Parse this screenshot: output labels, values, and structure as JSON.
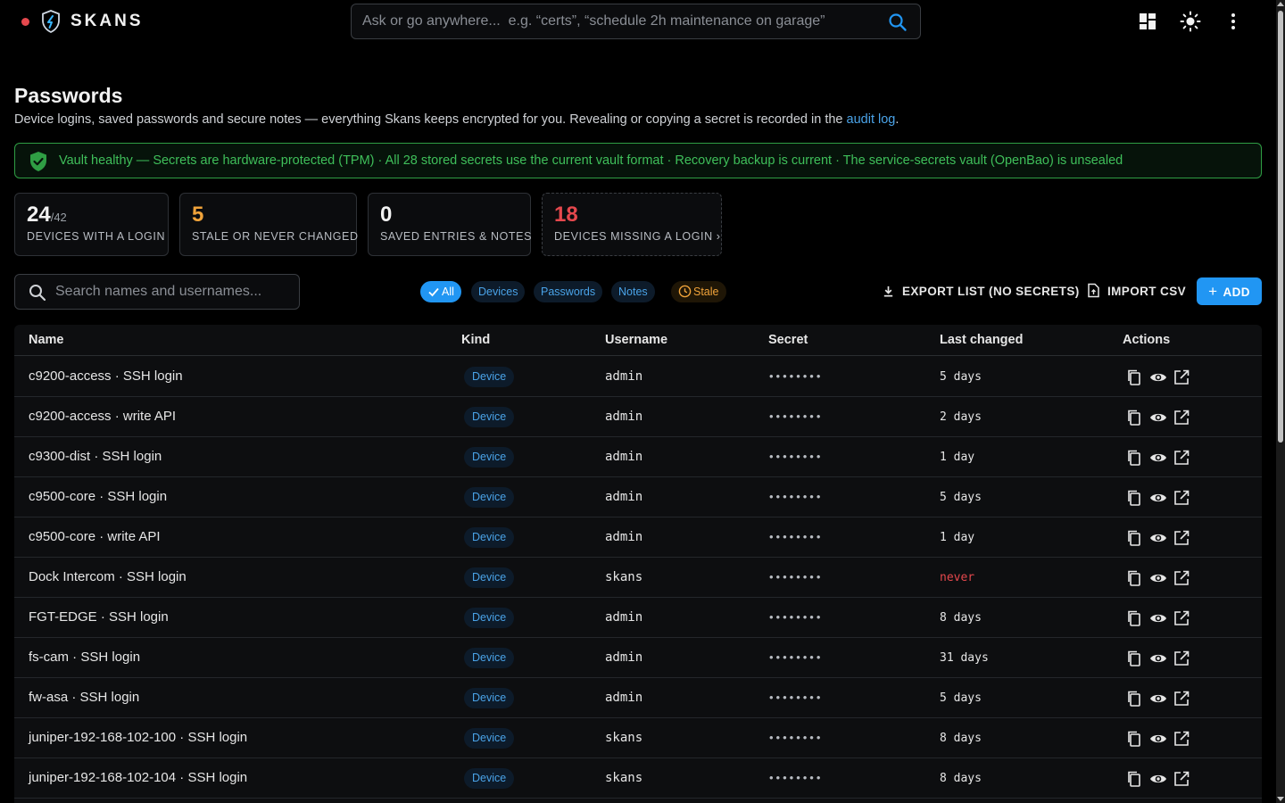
{
  "app": {
    "brand": "SKANS",
    "omnibox_placeholder": "Ask or go anywhere...  e.g. “certs”, “schedule 2h maintenance on garage”"
  },
  "page": {
    "title": "Passwords",
    "subtitle": "Device logins, saved passwords and secure notes — everything Skans keeps encrypted for you. Revealing or copying a secret is recorded in the ",
    "audit_link": "audit log",
    "subtitle_end": "."
  },
  "banner": {
    "text": "Vault healthy — Secrets are hardware-protected (TPM) · All 28 stored secrets use the current vault format · Recovery backup is current · The service-secrets vault (OpenBao) is unsealed"
  },
  "stats": [
    {
      "value": "24",
      "total": "/42",
      "label": "DEVICES WITH A LOGIN",
      "color": "#f2f2f2"
    },
    {
      "value": "5",
      "total": "",
      "label": "STALE OR NEVER CHANGED",
      "color": "#f0a33a"
    },
    {
      "value": "0",
      "total": "",
      "label": "SAVED ENTRIES & NOTES",
      "color": "#f2f2f2"
    },
    {
      "value": "18",
      "total": "",
      "label": "DEVICES MISSING A LOGIN ›",
      "color": "#e5484d"
    }
  ],
  "search": {
    "placeholder": "Search names and usernames..."
  },
  "filters": {
    "all": "All",
    "devices": "Devices",
    "passwords": "Passwords",
    "notes": "Notes",
    "stale": "Stale"
  },
  "toolbar": {
    "export": "EXPORT LIST (NO SECRETS)",
    "import": "IMPORT CSV",
    "add": "ADD"
  },
  "table": {
    "columns": {
      "name": "Name",
      "kind": "Kind",
      "username": "Username",
      "secret": "Secret",
      "changed": "Last changed",
      "actions": "Actions"
    },
    "rows": [
      {
        "name": "c9200-access · SSH login",
        "kind": "Device",
        "username": "admin",
        "secret": "••••••••",
        "changed": "5 days"
      },
      {
        "name": "c9200-access · write API",
        "kind": "Device",
        "username": "admin",
        "secret": "••••••••",
        "changed": "2 days"
      },
      {
        "name": "c9300-dist · SSH login",
        "kind": "Device",
        "username": "admin",
        "secret": "••••••••",
        "changed": "1 day"
      },
      {
        "name": "c9500-core · SSH login",
        "kind": "Device",
        "username": "admin",
        "secret": "••••••••",
        "changed": "5 days"
      },
      {
        "name": "c9500-core · write API",
        "kind": "Device",
        "username": "admin",
        "secret": "••••••••",
        "changed": "1 day"
      },
      {
        "name": "Dock Intercom · SSH login",
        "kind": "Device",
        "username": "skans",
        "secret": "••••••••",
        "changed": "never"
      },
      {
        "name": "FGT-EDGE · SSH login",
        "kind": "Device",
        "username": "admin",
        "secret": "••••••••",
        "changed": "8 days"
      },
      {
        "name": "fs-cam · SSH login",
        "kind": "Device",
        "username": "admin",
        "secret": "••••••••",
        "changed": "31 days"
      },
      {
        "name": "fw-asa · SSH login",
        "kind": "Device",
        "username": "admin",
        "secret": "••••••••",
        "changed": "5 days"
      },
      {
        "name": "juniper-192-168-102-100 · SSH login",
        "kind": "Device",
        "username": "skans",
        "secret": "••••••••",
        "changed": "8 days"
      },
      {
        "name": "juniper-192-168-102-104 · SSH login",
        "kind": "Device",
        "username": "skans",
        "secret": "••••••••",
        "changed": "8 days"
      }
    ]
  },
  "colors": {
    "accent": "#2196f3",
    "success": "#3fbf5a",
    "warning": "#f0a33a",
    "danger": "#e5484d"
  }
}
